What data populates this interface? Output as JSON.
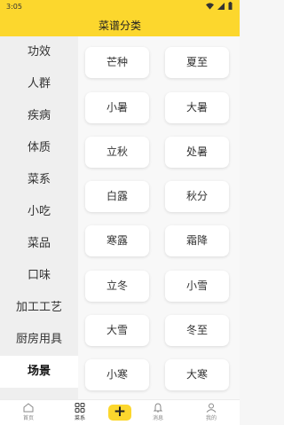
{
  "status_bar": {
    "time": "3:05",
    "icons": [
      "wifi-icon",
      "signal-icon",
      "battery-icon"
    ]
  },
  "header": {
    "title": "菜谱分类"
  },
  "colors": {
    "accent": "#fcd72d"
  },
  "sidebar": {
    "items": [
      {
        "label": "功效"
      },
      {
        "label": "人群"
      },
      {
        "label": "疾病"
      },
      {
        "label": "体质"
      },
      {
        "label": "菜系"
      },
      {
        "label": "小吃"
      },
      {
        "label": "菜品"
      },
      {
        "label": "口味"
      },
      {
        "label": "加工工艺"
      },
      {
        "label": "厨房用具"
      },
      {
        "label": "场景",
        "active": true
      }
    ]
  },
  "tags": [
    "芒种",
    "夏至",
    "小暑",
    "大暑",
    "立秋",
    "处暑",
    "白露",
    "秋分",
    "寒露",
    "霜降",
    "立冬",
    "小雪",
    "大雪",
    "冬至",
    "小寒",
    "大寒"
  ],
  "tabbar": {
    "tabs": [
      {
        "label": "首页",
        "icon": "home-icon"
      },
      {
        "label": "菜系",
        "icon": "grid-icon",
        "active": true
      },
      {
        "label": "",
        "icon": "plus-icon"
      },
      {
        "label": "消息",
        "icon": "bell-icon"
      },
      {
        "label": "我的",
        "icon": "user-icon"
      }
    ]
  }
}
